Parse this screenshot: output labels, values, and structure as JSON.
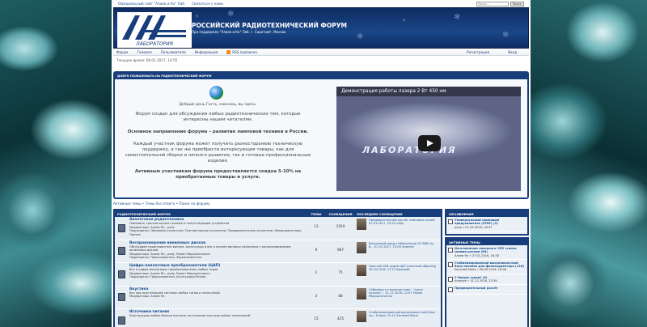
{
  "topbar": {
    "links": [
      "Официальный сайт \"Алаев и Ко\" Лаб.",
      "Связаться с нами"
    ],
    "search_placeholder": "Поиск...",
    "search_button": "Поиск"
  },
  "header": {
    "logo_text": "ЛАБОРАТОРИЯ",
    "title": "РОССИЙСКИЙ РАДИОТЕХНИЧЕСКИЙ ФОРУМ",
    "subtitle": "При поддержке \"Алаев и Ко\" Лаб. г. Саратов/г. Москва"
  },
  "nav": {
    "items": [
      "Форум",
      "Галерея",
      "Пользователи",
      "Информация"
    ],
    "rss": "RSS подписка",
    "right": [
      "Регистрация",
      "Вход"
    ]
  },
  "current_time": "Текущее время: 08.01.2017, 14:55",
  "welcome": {
    "header": "ДОБРО ПОЖАЛОВАТЬ НА РАДИОТЕХНИЧЕСКИЙ ФОРУМ",
    "greeting": "Добрый день Гость, наконец, вы здесь.",
    "p1": "Форум создан для обсуждения любых радиотехнических тем, которые интересны нашим читателям.",
    "p2": "Основное направление форума – развитие ламповой техники в России.",
    "p3": "Каждый участник форума может получить разносторонюю техническую поддержку, а так же приобрести интересующие товары, как для самостоятельной сборки и личного развития, так и готовые профессиональные изделия.",
    "p4": "Активным участникам форума предоставляется скидка 5-10% на приобретаемые товары и услуги.",
    "video_title": "Демонстрация работы лазера 2 Вт 450 нм",
    "video_logo": "ЛАБОРАТОРИЯ"
  },
  "breadcrumb": "Активные темы • Темы без ответа • Поиск по форуму",
  "forum_table": {
    "headers": [
      "РАДИОТЕХНИЧЕСКИЙ ФОРУМ",
      "ТЕМЫ",
      "СООБЩЕНИЯ",
      "ПОСЛЕДНЕЕ СООБЩЕНИЕ"
    ],
    "rows": [
      {
        "title": "Аналоговая радиотехника",
        "desc": "Ламповая, транзисторная техника и сопутствующие устройства",
        "mods": "Модераторы: Алаев Ян., pxdy",
        "subs": "Подразделы: Ламповые усилители, Транзисторные усилители, Предварительные усилители, Фонокорректоры, Прочее",
        "topics": "13",
        "posts": "1919",
        "last": "Предварительный расчёт ламповых цепей 02.01.2017, 23:25 pxdy"
      },
      {
        "title": "Воспроизведение виниловых дисков",
        "desc": "Обсуждаем проигрыватели винила, аксессуары и все о прочем вопросы связанные с воспроизведением виниловых дисков",
        "mods": "Модераторы: Алаев Ян., pxdy, Роман Мирошниченко",
        "subs": "Подразделы: Проигрыватели, Звукосниматели",
        "topics": "9",
        "posts": "987",
        "last": "Вакуумный диод-стабилизатор АТ 668 (ну б... 01.01.2017, 13:00 Andreyk"
      },
      {
        "title": "Цифро-аналоговые преобразователи (ЦАП)",
        "desc": "Все о цифро-аналоговых преобразователях любых типов",
        "mods": "Модераторы: Алаев Ян., pxdy, Роман Мирошниченко",
        "subs": "Подразделы: Проигрыватели, Аксессуары/Разное",
        "topics": "1",
        "posts": "75",
        "last": "Простой USB аудио ЦАП (опытный образец) 26.10.2016, 17:13 Валерий"
      },
      {
        "title": "Акустика",
        "desc": "Все про акустические системы любых типов и назначений",
        "mods": "Модераторы: Алаев Ян.",
        "subs": "",
        "topics": "3",
        "posts": "88",
        "last": "Сабвуфер в стерескистеме - \"каша музыки\"... 21.12.2016, 12:07 Роман Мирошниченко"
      },
      {
        "title": "Источники питания",
        "desc": "Конструкции любых блоков питания, источников тока для любых назначений",
        "mods": "",
        "subs": "",
        "topics": "15",
        "posts": "425",
        "last": "Стабилизированный высоковольтный блок пи... Вчера, 22:12 Евгений Моня"
      }
    ]
  },
  "announcements": {
    "header": "ОБЪЯВЛЕНИЯ",
    "items": [
      {
        "title": "Универсальный ламповый предусилитель (STAP) (2)",
        "meta": "pxdy » 01.03.2016, 16:37"
      }
    ]
  },
  "active_topics": {
    "header": "АКТИВНЫЕ ТЕМЫ",
    "items": [
      {
        "title": "Изготовление лазерного ЧПУ станка своими руками (84)",
        "meta": "Алаев Ян » 27.01.2016, 16:30"
      },
      {
        "title": "Стабилизированный высоковольтный блок питания для фонокорректора (116)",
        "meta": "Евгений Моня » 08.09.2016, 16:06"
      },
      {
        "title": "С Новым годом! (4)",
        "meta": "Andreyk » 31.12.2016, 23:39"
      },
      {
        "title": "Предварительный расчёт",
        "meta": ""
      }
    ]
  }
}
